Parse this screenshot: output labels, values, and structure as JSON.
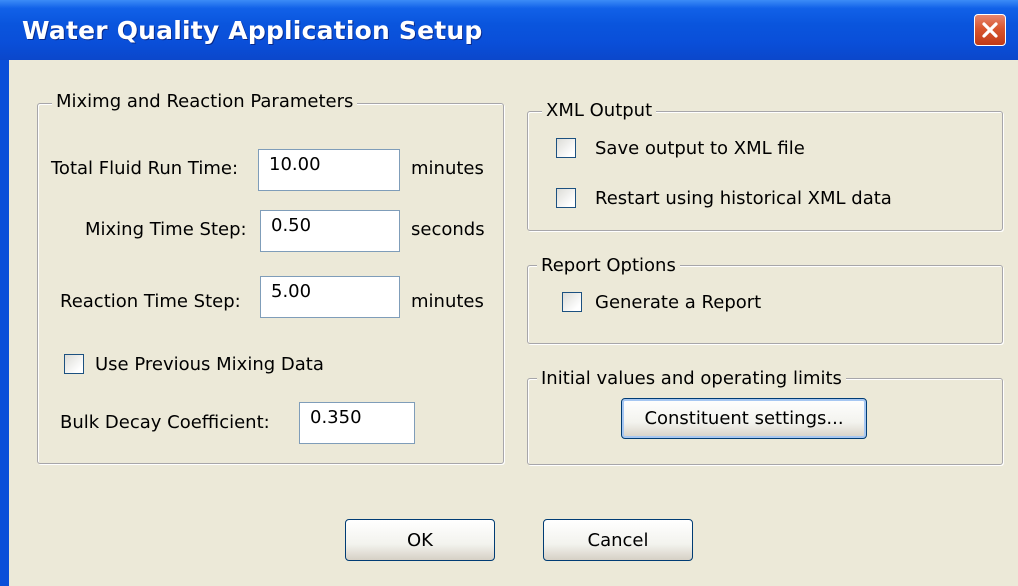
{
  "window": {
    "title": "Water Quality Application Setup"
  },
  "mixing_group": {
    "legend": "Miximg and Reaction Parameters",
    "run_time": {
      "label": "Total Fluid Run Time:",
      "value": "10.00",
      "unit": "minutes"
    },
    "mixing_step": {
      "label": "Mixing Time Step:",
      "value": "0.50",
      "unit": "seconds"
    },
    "reaction_step": {
      "label": "Reaction Time Step:",
      "value": "5.00",
      "unit": "minutes"
    },
    "use_previous": {
      "label": "Use Previous Mixing Data",
      "checked": false
    },
    "bulk_decay": {
      "label": "Bulk Decay Coefficient:",
      "value": "0.350"
    }
  },
  "xml_group": {
    "legend": "XML Output",
    "save_output": {
      "label": "Save output to XML file",
      "checked": false
    },
    "restart": {
      "label": "Restart using historical XML data",
      "checked": false
    }
  },
  "report_group": {
    "legend": "Report Options",
    "generate": {
      "label": "Generate a Report",
      "checked": false
    }
  },
  "initial_group": {
    "legend": "Initial values and operating limits",
    "constituent_button": "Constituent settings..."
  },
  "buttons": {
    "ok": "OK",
    "cancel": "Cancel"
  },
  "colors": {
    "title_bar": "#0a4fd9",
    "dialog_bg": "#ece9d8",
    "close_button": "#d8562f"
  }
}
